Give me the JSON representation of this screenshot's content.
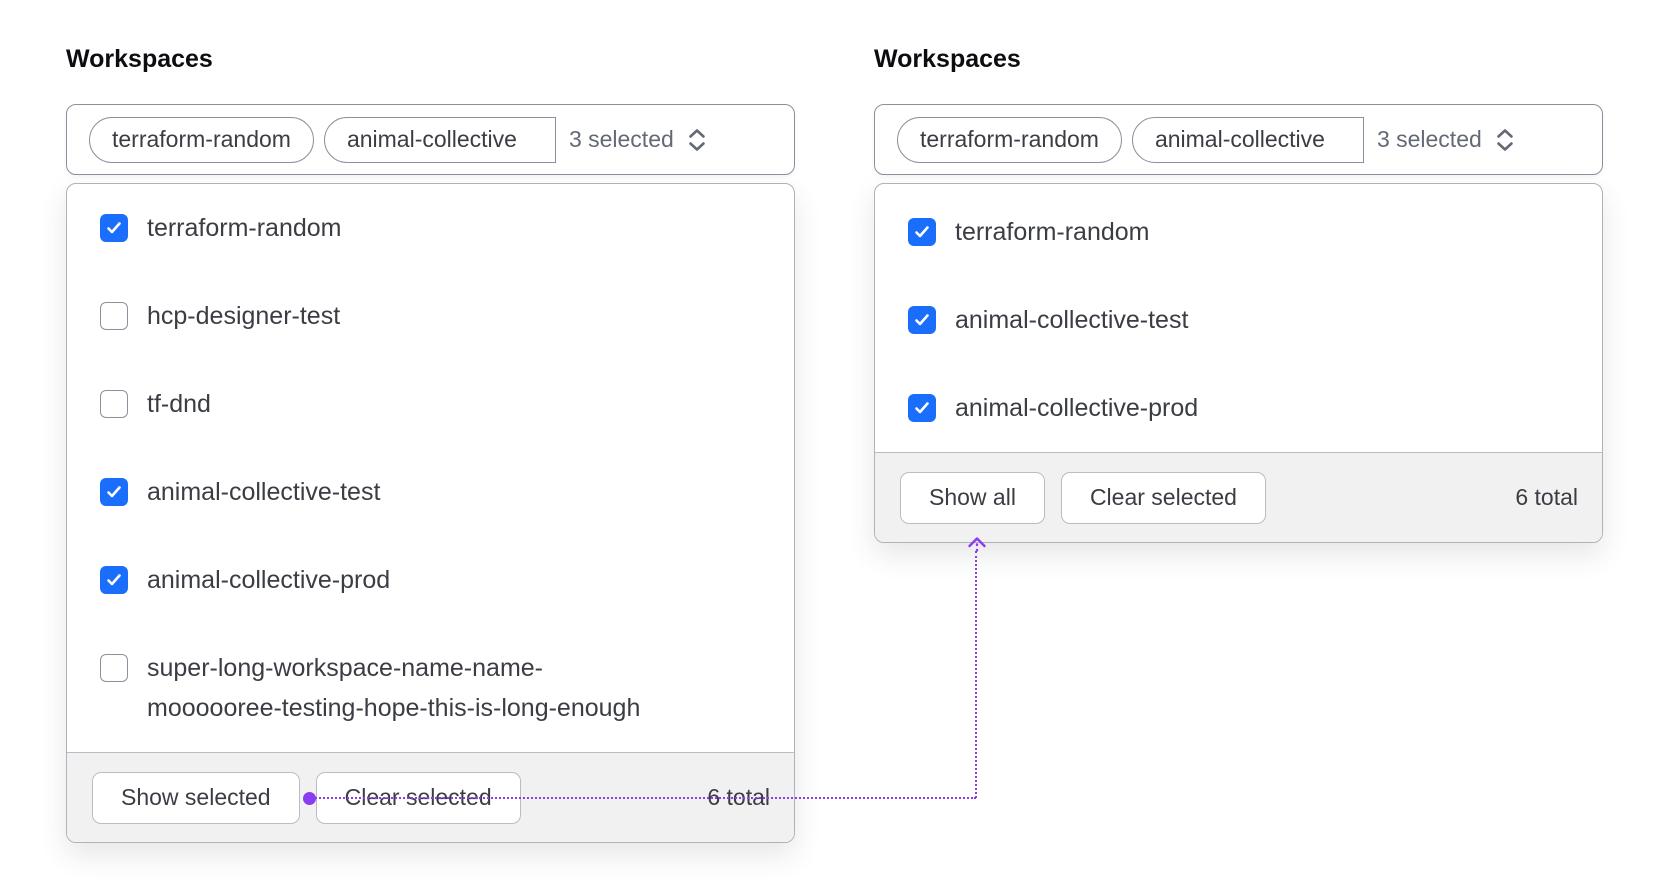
{
  "colors": {
    "checkbox_checked": "#1a6efb",
    "annotation_purple": "#8a3cf0",
    "text_primary": "#3b3d44",
    "text_muted": "#646a75",
    "footer_bg": "#f1f1f2"
  },
  "panels": [
    {
      "title": "Workspaces",
      "trigger": {
        "tags": [
          "terraform-random",
          "animal-collective"
        ],
        "summary": "3 selected"
      },
      "options": [
        {
          "label": "terraform-random",
          "checked": true
        },
        {
          "label": "hcp-designer-test",
          "checked": false
        },
        {
          "label": "tf-dnd",
          "checked": false
        },
        {
          "label": "animal-collective-test",
          "checked": true
        },
        {
          "label": "animal-collective-prod",
          "checked": true
        },
        {
          "label": "super-long-workspace-name-name-\nmoooooree-testing-hope-this-is-long-enough",
          "checked": false
        }
      ],
      "footer": {
        "show_button": "Show selected",
        "clear_button": "Clear selected",
        "total": "6 total"
      }
    },
    {
      "title": "Workspaces",
      "trigger": {
        "tags": [
          "terraform-random",
          "animal-collective"
        ],
        "summary": "3 selected"
      },
      "options": [
        {
          "label": "terraform-random",
          "checked": true
        },
        {
          "label": "animal-collective-test",
          "checked": true
        },
        {
          "label": "animal-collective-prod",
          "checked": true
        }
      ],
      "footer": {
        "show_button": "Show all",
        "clear_button": "Clear selected",
        "total": "6 total"
      }
    }
  ]
}
